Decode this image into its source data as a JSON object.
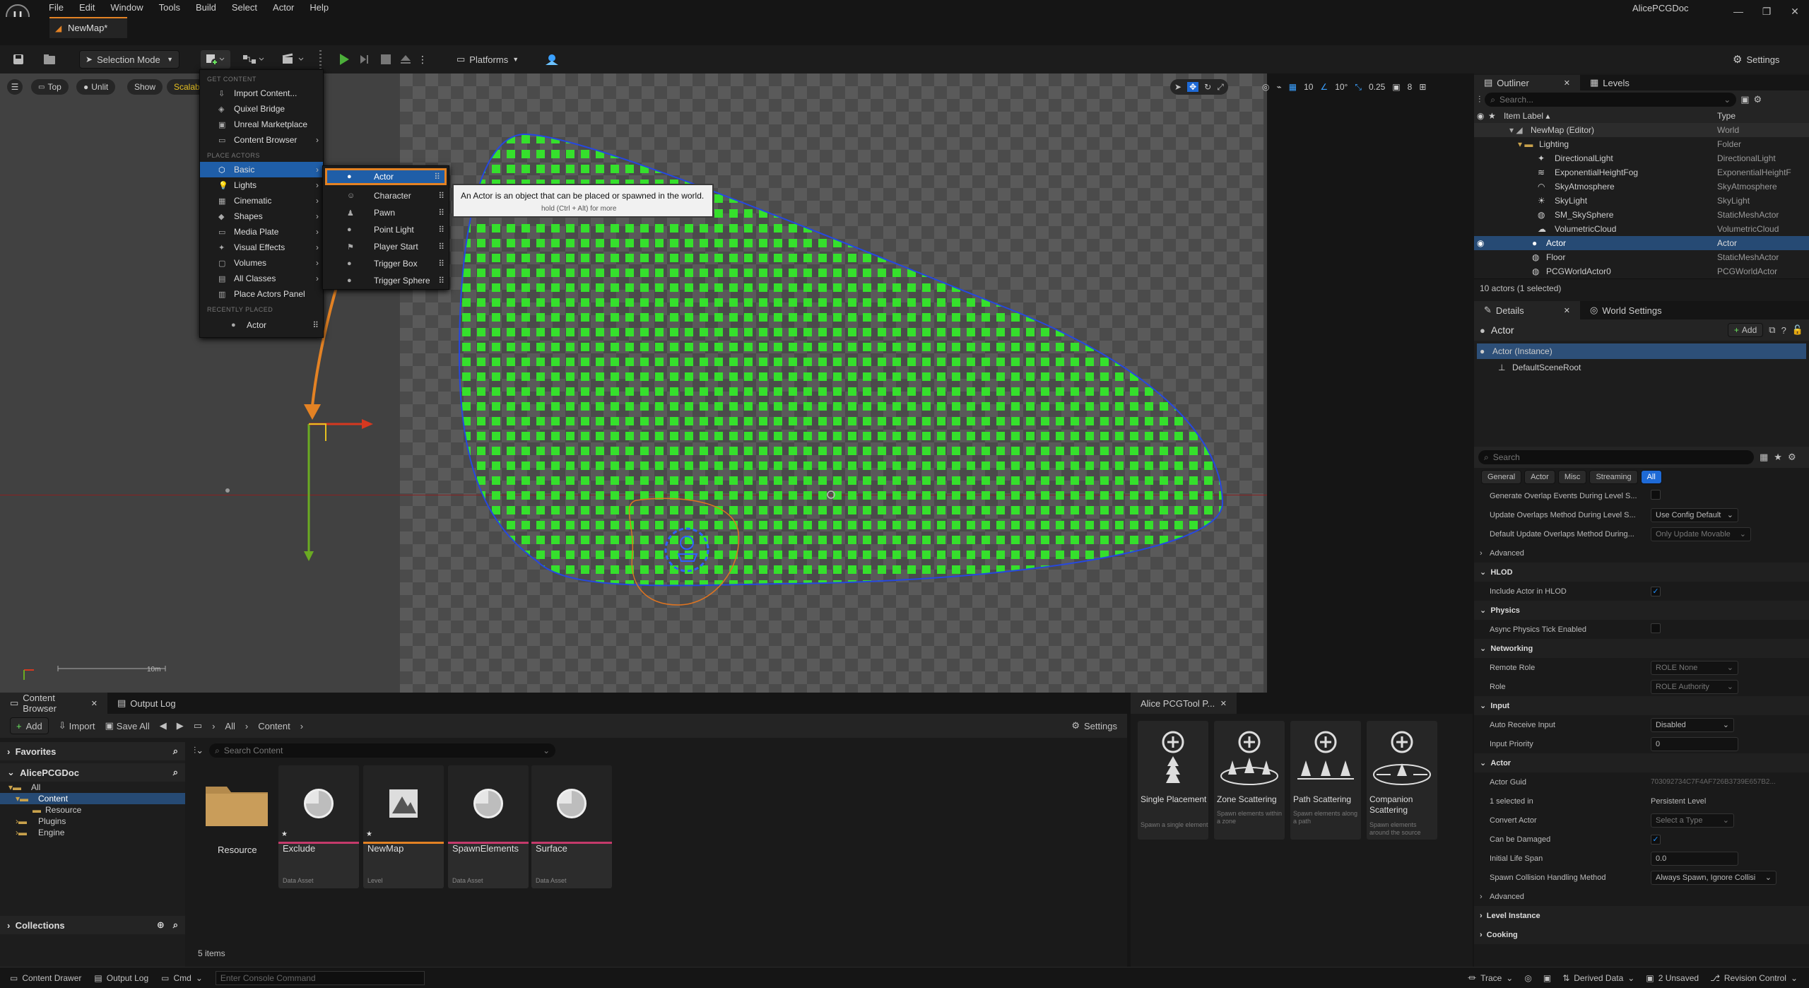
{
  "app": {
    "project": "AlicePCGDoc",
    "doc_tab": "NewMap*"
  },
  "menu": [
    "File",
    "Edit",
    "Window",
    "Tools",
    "Build",
    "Select",
    "Actor",
    "Help"
  ],
  "window_buttons": [
    "—",
    "❐",
    "✕"
  ],
  "toolbar": {
    "selection_mode": "Selection Mode",
    "platforms": "Platforms",
    "settings": "Settings"
  },
  "viewport": {
    "view": "Top",
    "lit": "Unlit",
    "show": "Show",
    "scalability": "Scalab",
    "grid": "10",
    "angle": "10°",
    "scale": "0.25",
    "cams": "8",
    "scale_label": "10m"
  },
  "add_menu": {
    "h_get": "GET CONTENT",
    "get": [
      "Import Content...",
      "Quixel Bridge",
      "Unreal Marketplace",
      "Content Browser"
    ],
    "h_place": "PLACE ACTORS",
    "place": [
      "Basic",
      "Lights",
      "Cinematic",
      "Shapes",
      "Media Plate",
      "Visual Effects",
      "Volumes",
      "All Classes"
    ],
    "place_panel": "Place Actors Panel",
    "h_recent": "RECENTLY PLACED",
    "recent": "Actor"
  },
  "basic_menu": [
    "Actor",
    "Character",
    "Pawn",
    "Point Light",
    "Player Start",
    "Trigger Box",
    "Trigger Sphere"
  ],
  "tooltip": {
    "text": "An Actor is an object that can be placed or spawned in the world.",
    "hint": "hold (Ctrl + Alt) for more"
  },
  "outliner": {
    "tab": "Outliner",
    "tab2": "Levels",
    "search": "Search...",
    "col_label": "Item Label ▴",
    "col_type": "Type",
    "rows": [
      {
        "l": "NewMap (Editor)",
        "t": "World"
      },
      {
        "l": "Lighting",
        "t": "Folder"
      },
      {
        "l": "DirectionalLight",
        "t": "DirectionalLight"
      },
      {
        "l": "ExponentialHeightFog",
        "t": "ExponentialHeightF"
      },
      {
        "l": "SkyAtmosphere",
        "t": "SkyAtmosphere"
      },
      {
        "l": "SkyLight",
        "t": "SkyLight"
      },
      {
        "l": "SM_SkySphere",
        "t": "StaticMeshActor"
      },
      {
        "l": "VolumetricCloud",
        "t": "VolumetricCloud"
      },
      {
        "l": "Actor",
        "t": "Actor"
      },
      {
        "l": "Floor",
        "t": "StaticMeshActor"
      },
      {
        "l": "PCGWorldActor0",
        "t": "PCGWorldActor"
      }
    ],
    "status": "10 actors (1 selected)"
  },
  "details": {
    "tab": "Details",
    "tab2": "World Settings",
    "actor": "Actor",
    "add": "Add",
    "instance": "Actor (Instance)",
    "root": "DefaultSceneRoot",
    "search": "Search",
    "filters": [
      "General",
      "Actor",
      "Misc",
      "Streaming",
      "All"
    ],
    "rows": {
      "gen_overlap": "Generate Overlap Events During Level S...",
      "upd_overlap": "Update Overlaps Method During Level S...",
      "upd_overlap_v": "Use Config Default",
      "def_overlap": "Default Update Overlaps Method During...",
      "def_overlap_v": "Only Update Movable",
      "advanced": "Advanced",
      "hlod": "HLOD",
      "hlod_inc": "Include Actor in HLOD",
      "physics": "Physics",
      "async": "Async Physics Tick Enabled",
      "networking": "Networking",
      "remote_role": "Remote Role",
      "remote_role_v": "ROLE None",
      "role": "Role",
      "role_v": "ROLE Authority",
      "input": "Input",
      "auto_recv": "Auto Receive Input",
      "auto_recv_v": "Disabled",
      "input_prio": "Input Priority",
      "input_prio_v": "0",
      "actor_cat": "Actor",
      "guid": "Actor Guid",
      "guid_v": "703092734C7F4AF726B3739E657B2...",
      "selected_in": "1 selected in",
      "selected_in_v": "Persistent Level",
      "convert": "Convert Actor",
      "convert_v": "Select a Type",
      "damaged": "Can be Damaged",
      "life": "Initial Life Span",
      "life_v": "0.0",
      "spawn": "Spawn Collision Handling Method",
      "spawn_v": "Always Spawn, Ignore Collisi",
      "advanced2": "Advanced",
      "level_inst": "Level Instance",
      "cooking": "Cooking"
    }
  },
  "content_browser": {
    "tab": "Content Browser",
    "tab2": "Output Log",
    "add": "Add",
    "import": "Import",
    "save_all": "Save All",
    "path": [
      "All",
      "Content"
    ],
    "settings": "Settings",
    "favorites": "Favorites",
    "project": "AlicePCGDoc",
    "tree": [
      "All",
      "Content",
      "Resource",
      "Plugins",
      "Engine"
    ],
    "search": "Search Content",
    "collections": "Collections",
    "count": "5 items",
    "assets": [
      {
        "name": "Resource",
        "type": ""
      },
      {
        "name": "Exclude",
        "type": "Data Asset"
      },
      {
        "name": "NewMap",
        "type": "Level"
      },
      {
        "name": "SpawnElements",
        "type": "Data Asset"
      },
      {
        "name": "Surface",
        "type": "Data Asset"
      }
    ]
  },
  "alice": {
    "tab": "Alice PCGTool P...",
    "tools": [
      {
        "name": "Single Placement",
        "desc": "Spawn a single element"
      },
      {
        "name": "Zone Scattering",
        "desc": "Spawn elements within a zone"
      },
      {
        "name": "Path Scattering",
        "desc": "Spawn elements along a path"
      },
      {
        "name": "Companion Scattering",
        "desc": "Spawn elements around the source"
      }
    ]
  },
  "status": {
    "drawer": "Content Drawer",
    "log": "Output Log",
    "cmd": "Cmd",
    "console": "Enter Console Command",
    "trace": "Trace",
    "derived": "Derived Data",
    "unsaved": "2 Unsaved",
    "revision": "Revision Control"
  },
  "colors": {
    "accent": "#e38224",
    "select": "#264a74",
    "pcg_points": "#35e02c",
    "spline": "#2648e0"
  }
}
